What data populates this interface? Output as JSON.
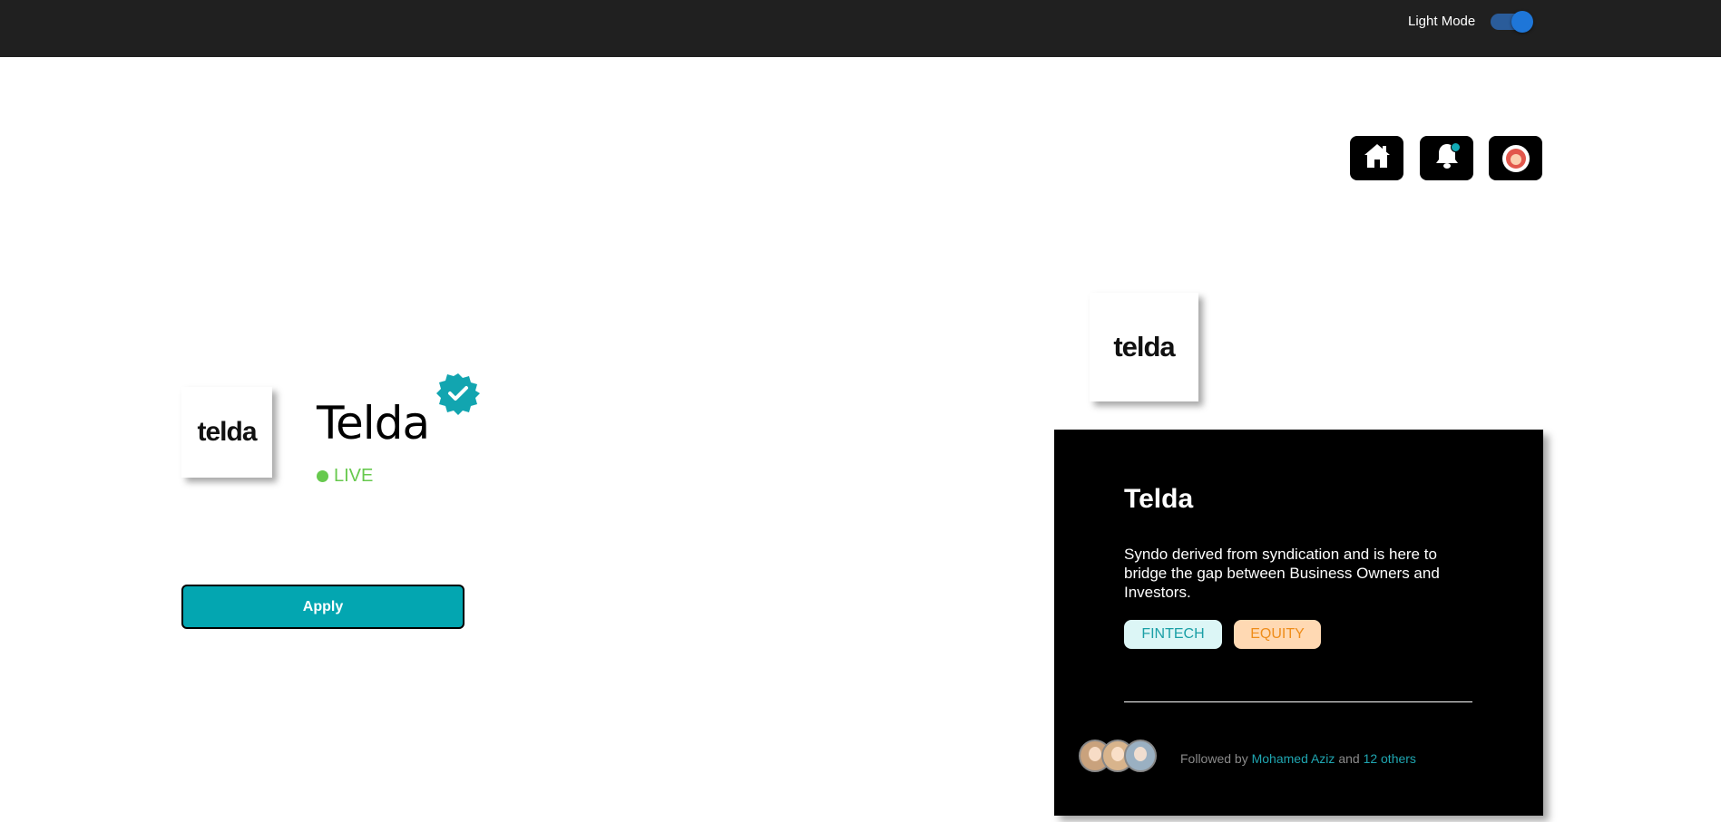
{
  "topbar": {
    "mode_label": "Light Mode",
    "mode_toggle_on": true
  },
  "nav": {
    "home_icon": "home-icon",
    "bell_icon": "bell-icon",
    "avatar_icon": "user-avatar",
    "bell_has_notification": true
  },
  "company": {
    "logo_text": "telda",
    "name": "Telda",
    "verified": true,
    "status": "LIVE",
    "status_color": "#67c94e"
  },
  "actions": {
    "apply_label": "Apply",
    "apply_color": "#03a6b1"
  },
  "card": {
    "logo_text": "telda",
    "title": "Telda",
    "description": "Syndo derived from syndication and is here to bridge the gap between Business Owners and Investors.",
    "tags": [
      {
        "label": "FINTECH",
        "bg": "#dcf6f6",
        "color": "#1a9fa6"
      },
      {
        "label": "EQUITY",
        "bg": "#ffd9b3",
        "color": "#ef8d1a"
      }
    ],
    "followers": {
      "prefix": "Followed by",
      "name": "Mohamed Aziz",
      "conjunction": "and",
      "others": "12 others",
      "avatar_count": 3
    }
  },
  "colors": {
    "topbar_bg": "#202020",
    "accent": "#03a6b1",
    "card_bg": "#000000"
  }
}
